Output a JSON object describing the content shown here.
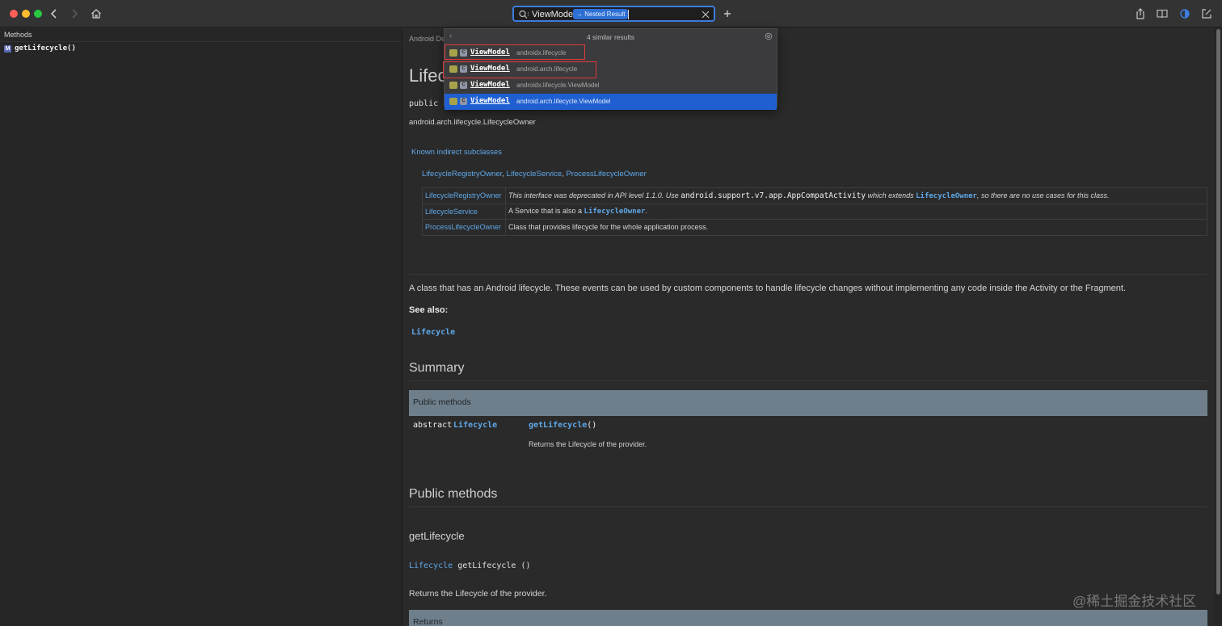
{
  "window": {
    "search_query": "ViewModel",
    "search_badge": "→ Nested Result",
    "colors": {
      "accent": "#3b7ddd",
      "selection": "#1f5fd1",
      "highlight": "#e0393b"
    }
  },
  "sidebar": {
    "title": "Methods",
    "items": [
      {
        "badge": "M",
        "label": "getLifecycle()"
      }
    ]
  },
  "dropdown": {
    "count_label": "4 similar results",
    "results": [
      {
        "name": "ViewModel",
        "package": "androidx.lifecycle"
      },
      {
        "name": "ViewModel",
        "package": "android.arch.lifecycle"
      },
      {
        "name": "ViewModel",
        "package": "androidx.lifecycle.ViewModel"
      },
      {
        "name": "ViewModel",
        "package": "android.arch.lifecycle.ViewModel"
      }
    ]
  },
  "doc": {
    "breadcrumb": "Android De",
    "title": "Lifecyc",
    "public_decl": "public i",
    "iface": "android.arch.lifecycle.LifecycleOwner",
    "known_indirect": "Known indirect subclasses",
    "subclasses": [
      "LifecycleRegistryOwner",
      "LifecycleService",
      "ProcessLifecycleOwner"
    ],
    "sep": ", ",
    "table": [
      {
        "name": "LifecycleRegistryOwner",
        "a": "This interface was deprecated in API level 1.1.0. Use ",
        "code": "android.support.v7.app.AppCompatActivity",
        "b": " which extends ",
        "link": "LifecycleOwner",
        "c": ", so there are no use cases for this class."
      },
      {
        "name": "LifecycleService",
        "a": "A Service that is also a ",
        "link": "LifecycleOwner",
        "c": "."
      },
      {
        "name": "ProcessLifecycleOwner",
        "a": "Class that provides lifecycle for the whole application process."
      }
    ],
    "description": "A class that has an Android lifecycle. These events can be used by custom components to handle lifecycle changes without implementing any code inside the Activity or the Fragment.",
    "see_also": "See also:",
    "see_also_link": "Lifecycle",
    "summary_heading": "Summary",
    "public_methods_bar": "Public methods",
    "abstract_kw": "abstract",
    "return_type": "Lifecycle",
    "method_call": "getLifecycle",
    "parens": "()",
    "method_desc": "Returns the Lifecycle of the provider.",
    "public_methods_heading": "Public methods",
    "method_heading": "getLifecycle",
    "sig_type": "Lifecycle",
    "sig_rest": " getLifecycle ()",
    "returns_desc": "Returns the Lifecycle of the provider.",
    "returns_bar": "Returns"
  },
  "watermark": "@稀土掘金技术社区"
}
